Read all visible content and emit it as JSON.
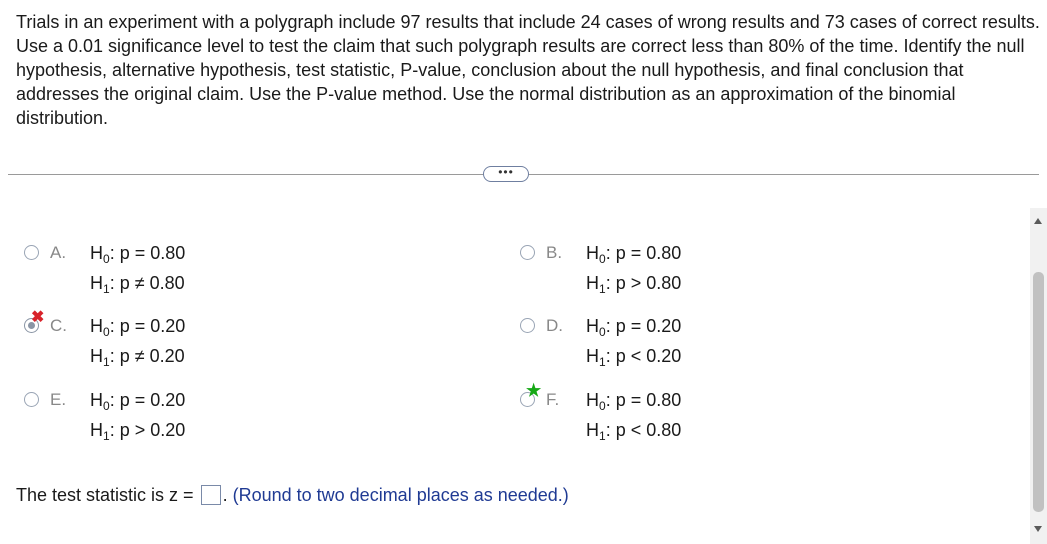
{
  "question": {
    "text": "Trials in an experiment with a polygraph include 97 results that include 24 cases of wrong results and 73 cases of correct results. Use a 0.01 significance level to test the claim that such polygraph results are correct less than 80% of the time. Identify the null hypothesis, alternative hypothesis, test statistic, P-value, conclusion about the null hypothesis, and final conclusion that addresses the original claim. Use the P-value method. Use the normal distribution as an approximation of the binomial distribution."
  },
  "more_button": {
    "label": "•••"
  },
  "options": [
    {
      "letter": "A.",
      "h0": "p = 0.80",
      "h1": "p ≠ 0.80",
      "state": "unselected"
    },
    {
      "letter": "B.",
      "h0": "p = 0.80",
      "h1": "p > 0.80",
      "state": "unselected"
    },
    {
      "letter": "C.",
      "h0": "p = 0.20",
      "h1": "p ≠ 0.20",
      "state": "selected-incorrect"
    },
    {
      "letter": "D.",
      "h0": "p = 0.20",
      "h1": "p < 0.20",
      "state": "unselected"
    },
    {
      "letter": "E.",
      "h0": "p = 0.20",
      "h1": "p > 0.20",
      "state": "unselected"
    },
    {
      "letter": "F.",
      "h0": "p = 0.80",
      "h1": "p < 0.80",
      "state": "correct-answer"
    }
  ],
  "hyp_labels": {
    "h": "H",
    "null_sub": "0",
    "alt_sub": "1",
    "sep": ": "
  },
  "answer": {
    "prefix": "The test statistic is z =",
    "value": "",
    "suffix": ".",
    "hint": "(Round to two decimal places as needed.)"
  },
  "colors": {
    "incorrect": "#d8222a",
    "correct": "#16a816",
    "hint": "#1f3a93"
  },
  "icons": {
    "incorrect": "x-mark-icon",
    "correct": "star-icon"
  }
}
